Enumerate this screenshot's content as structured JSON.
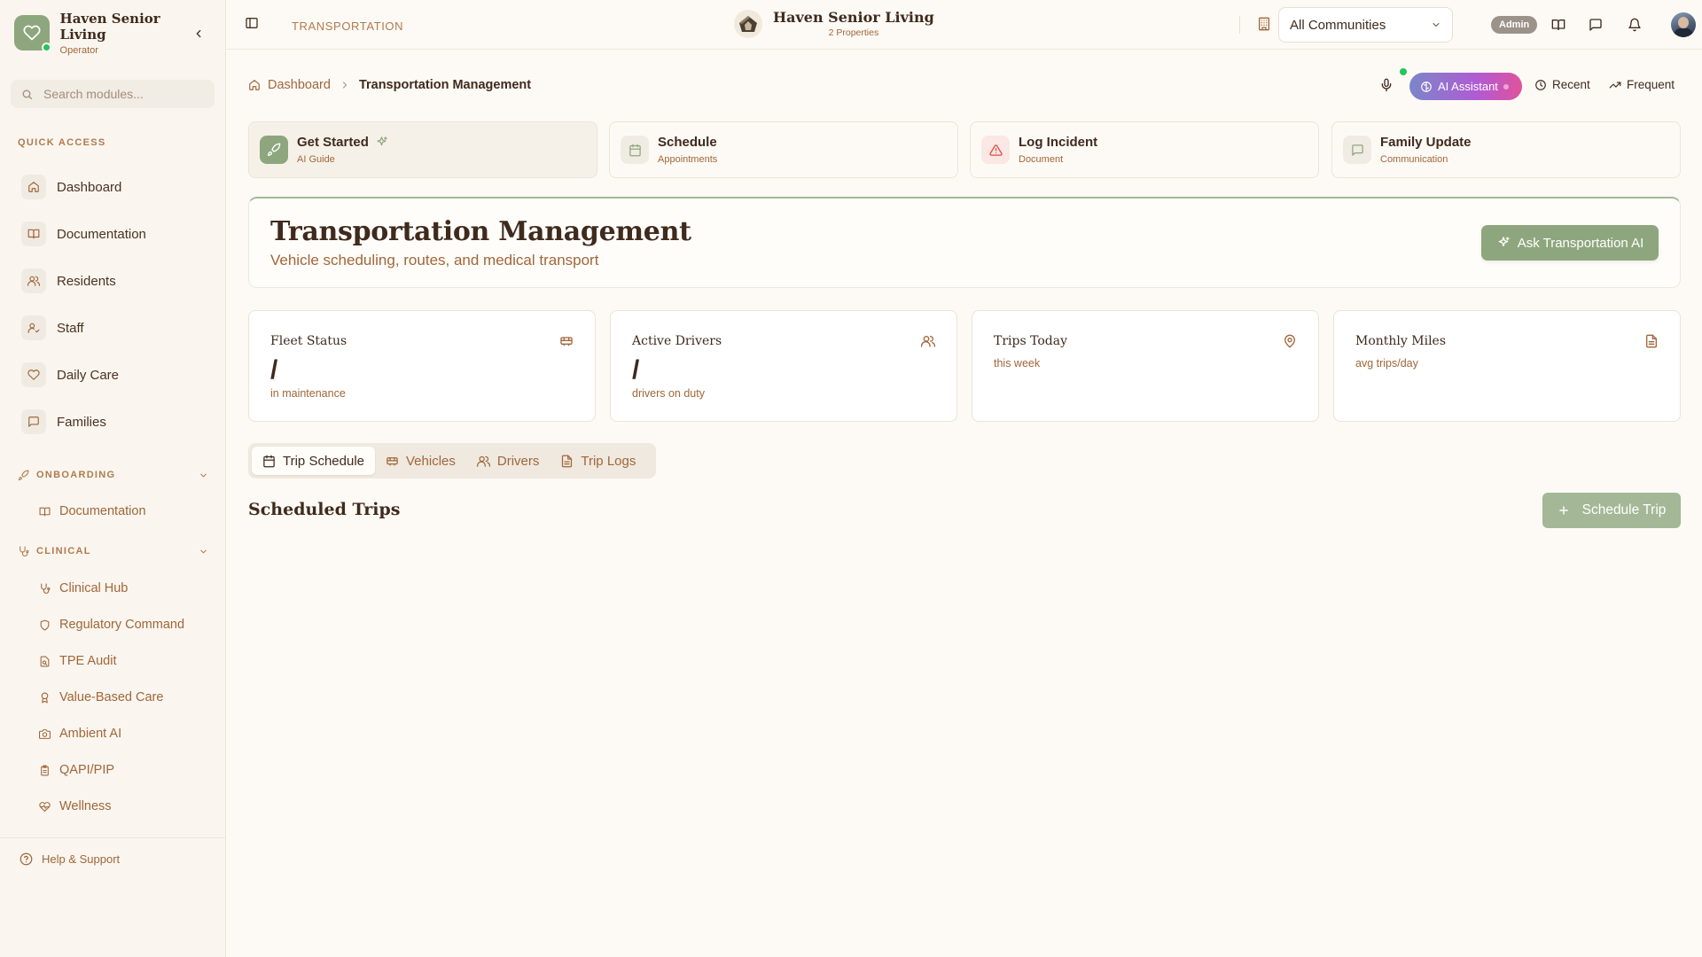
{
  "sidebar": {
    "brand_name": "Haven Senior Living",
    "brand_role": "Operator",
    "search_placeholder": "Search modules...",
    "quick_access_label": "QUICK ACCESS",
    "quick_items": [
      {
        "label": "Dashboard",
        "icon": "home-icon"
      },
      {
        "label": "Documentation",
        "icon": "book-icon"
      },
      {
        "label": "Residents",
        "icon": "users-icon"
      },
      {
        "label": "Staff",
        "icon": "user-check-icon"
      },
      {
        "label": "Daily Care",
        "icon": "heart-icon"
      },
      {
        "label": "Families",
        "icon": "message-icon"
      }
    ],
    "onboarding": {
      "label": "ONBOARDING",
      "items": [
        {
          "label": "Documentation",
          "icon": "book-icon"
        }
      ]
    },
    "clinical": {
      "label": "CLINICAL",
      "items": [
        {
          "label": "Clinical Hub",
          "icon": "stethoscope-icon"
        },
        {
          "label": "Regulatory Command",
          "icon": "shield-icon"
        },
        {
          "label": "TPE Audit",
          "icon": "file-search-icon"
        },
        {
          "label": "Value-Based Care",
          "icon": "award-icon"
        },
        {
          "label": "Ambient AI",
          "icon": "camera-icon"
        },
        {
          "label": "QAPI/PIP",
          "icon": "clipboard-icon"
        },
        {
          "label": "Wellness",
          "icon": "heart-pulse-icon"
        }
      ]
    },
    "help_label": "Help & Support"
  },
  "header": {
    "page_tag": "TRANSPORTATION",
    "center_brand": "Haven Senior Living",
    "center_sub": "2 Properties",
    "community_select": "All Communities",
    "admin_badge": "Admin"
  },
  "breadcrumb": {
    "home": "Dashboard",
    "current": "Transportation Management"
  },
  "toolbar": {
    "ai_label": "AI Assistant",
    "recent_label": "Recent",
    "frequent_label": "Frequent"
  },
  "action_cards": [
    {
      "title": "Get Started",
      "subtitle": "AI Guide"
    },
    {
      "title": "Schedule",
      "subtitle": "Appointments"
    },
    {
      "title": "Log Incident",
      "subtitle": "Document"
    },
    {
      "title": "Family Update",
      "subtitle": "Communication"
    }
  ],
  "hero": {
    "title": "Transportation Management",
    "subtitle": "Vehicle scheduling, routes, and medical transport",
    "button_label": "Ask Transportation AI"
  },
  "stats": [
    {
      "title": "Fleet Status",
      "value": "/",
      "subtitle": "in maintenance"
    },
    {
      "title": "Active Drivers",
      "value": "/",
      "subtitle": "drivers on duty"
    },
    {
      "title": "Trips Today",
      "value": "",
      "subtitle": "this week"
    },
    {
      "title": "Monthly Miles",
      "value": "",
      "subtitle": "avg trips/day"
    }
  ],
  "tabs": [
    {
      "label": "Trip Schedule"
    },
    {
      "label": "Vehicles"
    },
    {
      "label": "Drivers"
    },
    {
      "label": "Trip Logs"
    }
  ],
  "section": {
    "title": "Scheduled Trips",
    "button_label": "Schedule Trip"
  },
  "colors": {
    "accent": "#8ea67e",
    "brown": "#a0663a",
    "text": "#3f2a1d",
    "background": "#fdfaf5"
  }
}
